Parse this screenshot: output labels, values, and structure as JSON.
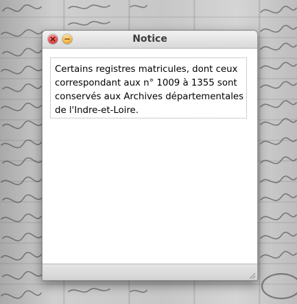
{
  "window": {
    "title": "Notice",
    "message": "Certains registres matricules, dont ceux correspondant aux n° 1009 à 1355 sont conservés aux Archives départementales de l'Indre-et-Loire.",
    "buttons": [
      {
        "name": "close",
        "icon": "close-icon",
        "color": "#e05252"
      },
      {
        "name": "minimize",
        "icon": "minimize-icon",
        "color": "#f3b645"
      }
    ]
  }
}
